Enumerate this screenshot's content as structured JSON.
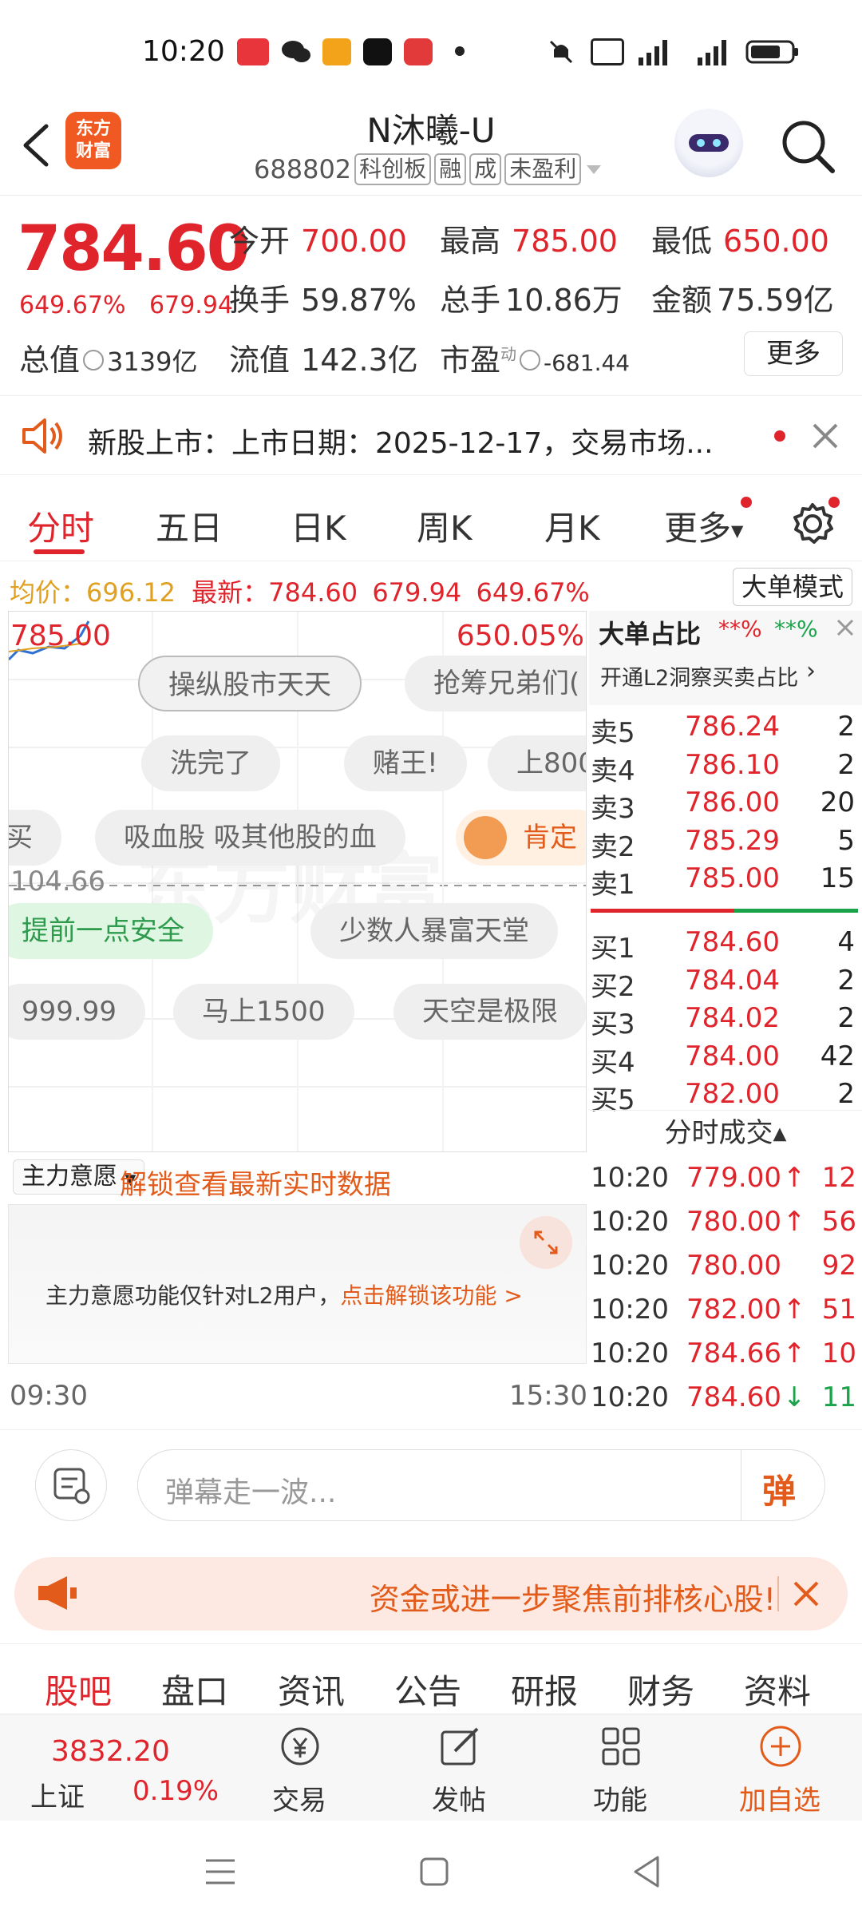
{
  "status_bar": {
    "time": "10:20",
    "app_icons": [
      "toutiao-icon",
      "wechat-icon",
      "58-icon",
      "tiktok-icon",
      "tiktok-lite-icon"
    ],
    "right_icons": [
      "mute-icon",
      "hd2-icon",
      "4g-signal-icon",
      "5g-signal-icon",
      "battery-icon"
    ]
  },
  "header": {
    "brand": "东方\n财富",
    "stock_name": "N沐曦-U",
    "stock_code": "688802",
    "tags": [
      "科创板",
      "融",
      "成",
      "未盈利"
    ]
  },
  "quote": {
    "price": "784.60",
    "change_pct": "649.67%",
    "change": "679.94",
    "open_label": "今开",
    "open": "700.00",
    "high_label": "最高",
    "high": "785.00",
    "low_label": "最低",
    "low": "650.00",
    "turnover_label": "换手",
    "turnover": "59.87%",
    "volume_label": "总手",
    "volume": "10.86万",
    "amount_label": "金额",
    "amount": "75.59亿",
    "mktcap_label": "总值",
    "mktcap": "3139亿",
    "float_label": "流值",
    "float": "142.3亿",
    "pe_label": "市盈",
    "pe_sup": "动",
    "pe": "-681.44",
    "more": "更多"
  },
  "notice": {
    "text": "新股上市：上市日期：2025-12-17，交易市场..."
  },
  "tabs": [
    "分时",
    "五日",
    "日K",
    "周K",
    "月K",
    "更多"
  ],
  "avg_line": {
    "avg_label": "均价：",
    "avg": "696.12",
    "latest_label": "最新：",
    "latest": "784.60",
    "change": "679.94",
    "pct": "649.67%",
    "big_mode": "大单模式"
  },
  "chart": {
    "top_price": "785.00",
    "top_pct": "650.05%",
    "mid_price": "104.66",
    "time_start": "09:30",
    "time_end": "15:30",
    "danmu": [
      "操纵股市天天",
      "抢筹兄弟们(",
      "洗完了",
      "赌王!",
      "上800",
      "买",
      "吸血股 吸其他股的血",
      "肯定",
      "提前一点安全",
      "少数人暴富天堂",
      "999.99",
      "马上1500",
      "天空是极限"
    ],
    "watermark": "东方财富"
  },
  "order_book": {
    "big_order_title": "大单占比",
    "big_order_red": "**%",
    "big_order_green": "**%",
    "l2_link": "开通L2洞察买卖占比",
    "asks": [
      {
        "label": "卖5",
        "price": "786.24",
        "vol": "2"
      },
      {
        "label": "卖4",
        "price": "786.10",
        "vol": "2"
      },
      {
        "label": "卖3",
        "price": "786.00",
        "vol": "20"
      },
      {
        "label": "卖2",
        "price": "785.29",
        "vol": "5"
      },
      {
        "label": "卖1",
        "price": "785.00",
        "vol": "15"
      }
    ],
    "bids": [
      {
        "label": "买1",
        "price": "784.60",
        "vol": "4"
      },
      {
        "label": "买2",
        "price": "784.04",
        "vol": "2"
      },
      {
        "label": "买3",
        "price": "784.02",
        "vol": "2"
      },
      {
        "label": "买4",
        "price": "784.00",
        "vol": "42"
      },
      {
        "label": "买5",
        "price": "782.00",
        "vol": "2"
      }
    ],
    "trades_title": "分时成交",
    "trades": [
      {
        "time": "10:20",
        "price": "779.00",
        "arrow": "↑",
        "vol": "12",
        "color": "#e0242b"
      },
      {
        "time": "10:20",
        "price": "780.00",
        "arrow": "↑",
        "vol": "56",
        "color": "#e0242b"
      },
      {
        "time": "10:20",
        "price": "780.00",
        "arrow": "",
        "vol": "92",
        "color": "#e0242b"
      },
      {
        "time": "10:20",
        "price": "782.00",
        "arrow": "↑",
        "vol": "51",
        "color": "#e0242b"
      },
      {
        "time": "10:20",
        "price": "784.66",
        "arrow": "↑",
        "vol": "10",
        "color": "#e0242b"
      },
      {
        "time": "10:20",
        "price": "784.60",
        "arrow": "↓",
        "vol": "11",
        "color": "#1aa34a"
      }
    ]
  },
  "main_force": {
    "select": "主力意愿",
    "unlock": "解锁查看最新实时数据",
    "text": "主力意愿功能仅针对L2用户，",
    "link": "点击解锁该功能 >"
  },
  "comment": {
    "placeholder": "弹幕走一波...",
    "send": "弹"
  },
  "promo": {
    "text": "资金或进一步聚焦前排核心股!"
  },
  "section_tabs": [
    "股吧",
    "盘口",
    "资讯",
    "公告",
    "研报",
    "财务",
    "资料"
  ],
  "bottom_nav": {
    "index_value": "3832.20",
    "index_name": "上证",
    "index_pct": "0.19%",
    "items": [
      "交易",
      "发帖",
      "功能",
      "加自选"
    ]
  },
  "colors": {
    "up": "#e0242b",
    "down": "#1aa34a",
    "accent": "#e35b1a"
  }
}
